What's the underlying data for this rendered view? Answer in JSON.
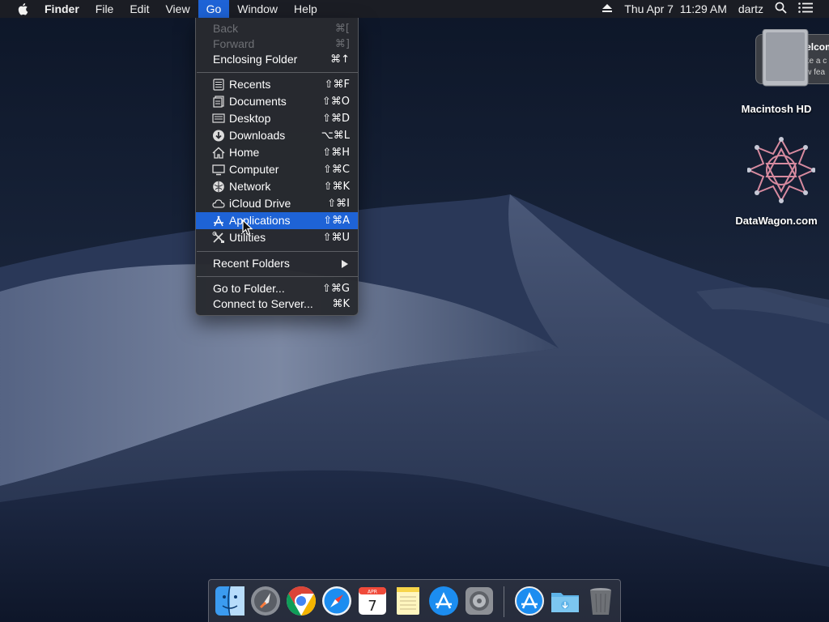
{
  "menubar": {
    "app_name": "Finder",
    "menus": [
      "File",
      "Edit",
      "View",
      "Go",
      "Window",
      "Help"
    ],
    "active_menu": "Go",
    "status": {
      "datetime": "Thu Apr 7  11:29 AM",
      "user": "dartz"
    },
    "icons": [
      "apple-icon",
      "eject-icon",
      "spotlight-search-icon",
      "notification-center-icon"
    ]
  },
  "go_menu": {
    "items": [
      {
        "label": "Back",
        "shortcut": "⌘[",
        "disabled": true
      },
      {
        "label": "Forward",
        "shortcut": "⌘]",
        "disabled": true
      },
      {
        "label": "Enclosing Folder",
        "shortcut": "⌘↑"
      },
      {
        "label": "Recents",
        "shortcut": "⇧⌘F",
        "icon": "recents-icon"
      },
      {
        "label": "Documents",
        "shortcut": "⇧⌘O",
        "icon": "documents-icon"
      },
      {
        "label": "Desktop",
        "shortcut": "⇧⌘D",
        "icon": "desktop-icon"
      },
      {
        "label": "Downloads",
        "shortcut": "⌥⌘L",
        "icon": "downloads-icon"
      },
      {
        "label": "Home",
        "shortcut": "⇧⌘H",
        "icon": "home-icon"
      },
      {
        "label": "Computer",
        "shortcut": "⇧⌘C",
        "icon": "computer-icon"
      },
      {
        "label": "Network",
        "shortcut": "⇧⌘K",
        "icon": "network-icon"
      },
      {
        "label": "iCloud Drive",
        "shortcut": "⇧⌘I",
        "icon": "icloud-icon"
      },
      {
        "label": "Applications",
        "shortcut": "⇧⌘A",
        "icon": "applications-icon",
        "highlighted": true
      },
      {
        "label": "Utilities",
        "shortcut": "⇧⌘U",
        "icon": "utilities-icon"
      },
      {
        "label": "Recent Folders",
        "submenu": true
      },
      {
        "label": "Go to Folder...",
        "shortcut": "⇧⌘G"
      },
      {
        "label": "Connect to Server...",
        "shortcut": "⌘K"
      }
    ]
  },
  "desktop": {
    "icons": [
      {
        "label": "Macintosh HD",
        "icon": "hard-drive-icon"
      },
      {
        "label": "DataWagon.com",
        "icon": "datawagon-icon"
      }
    ]
  },
  "notification": {
    "title": "Welcom",
    "body_line1": "Take a c",
    "body_line2": "new fea"
  },
  "dock": {
    "apps": [
      "finder-icon",
      "launchpad-icon",
      "chrome-icon",
      "safari-icon",
      "calendar-icon",
      "notes-icon",
      "app-store-icon",
      "system-preferences-icon",
      "applications-folder-icon",
      "downloads-folder-icon",
      "trash-icon"
    ],
    "calendar": {
      "month": "APR",
      "day": "7"
    }
  },
  "colors": {
    "highlight": "#1e63d6",
    "menu_bg": "#28292f",
    "menubar_bg": "#1c1e24"
  }
}
